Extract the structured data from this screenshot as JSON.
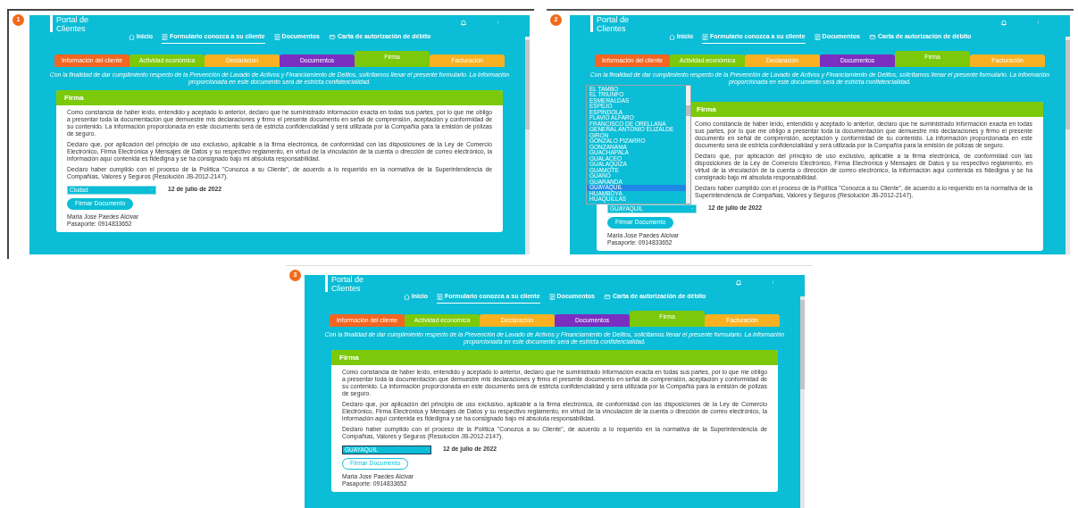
{
  "panels": [
    {
      "badge": "1",
      "portal_title": [
        "Portal de",
        "Clientes"
      ],
      "nav": [
        {
          "kind": "home",
          "label": "Inicio",
          "selected": false
        },
        {
          "kind": "form",
          "label": "Formulario conozca a su cliente",
          "selected": true
        },
        {
          "kind": "documents",
          "label": "Documentos",
          "selected": false
        },
        {
          "kind": "card",
          "label": "Carta de autorización de débito",
          "selected": false
        }
      ],
      "tabs": [
        {
          "label": "Información del cliente",
          "color": "#f26522",
          "selected": false
        },
        {
          "label": "Actividad económica",
          "color": "#7cc90c",
          "selected": false
        },
        {
          "label": "Declaración",
          "color": "#f9b122",
          "selected": false
        },
        {
          "label": "Documentos",
          "color": "#7a2fc0",
          "selected": false
        },
        {
          "label": "Firma",
          "color": "#7cc90c",
          "selected": true
        },
        {
          "label": "Facturación",
          "color": "#f9b122",
          "selected": false
        }
      ],
      "intro": "Con la finalidad de dar cumplimiento respecto de la Prevención de Lavado de Activos y Financiamiento de Delitos, solicitamos llenar el presente formulario. La información proporcionada en este documento será de estricta confidencialidad.",
      "card": {
        "title": "Firma",
        "paragraphs": [
          "Como constancia de haber leído, entendido y aceptado lo anterior, declaro que he suministrado información exacta en todas sus partes, por lo que me obligo a presentar toda la documentación que demuestre mis declaraciones y firmo el presente documento en señal de comprensión, aceptación y conformidad de su contenido. La información proporcionada en este documento será de estricta confidencialidad y será utilizada por la Compañía para la emisión de pólizas de seguro.",
          "Declaro que, por aplicación del principio de uso exclusivo, aplicable a la firma electrónica, de conformidad con las disposiciones de la Ley de Comercio Electrónico, Firma Electrónica y Mensajes de Datos y su respectivo reglamento, en virtud de la vinculación de la cuenta o dirección de correo electrónico, la información aquí contenida es fidedigna y se ha consignado bajo mi absoluta responsabilidad.",
          "Declaro haber cumplido con el proceso de la Política \"Conozca a su Cliente\", de acuerdo a lo requerido en la normativa de la Superintendencia de Compañías, Valores y Seguros (Resolución JB-2012-2147)."
        ],
        "city_select": {
          "value": "Ciudad",
          "open": false,
          "focused": false
        },
        "date": "12 de julio de 2022",
        "sign_button": {
          "label": "Firmar Documento",
          "hovered": false
        },
        "signer_lines": [
          "Maria Jose Paedes Alcivar",
          "Pasaporte: 0914833652"
        ]
      }
    },
    {
      "badge": "2",
      "portal_title": [
        "Portal de",
        "Clientes"
      ],
      "nav": [
        {
          "kind": "home",
          "label": "Inicio",
          "selected": false
        },
        {
          "kind": "form",
          "label": "Formulario conozca a su cliente",
          "selected": true
        },
        {
          "kind": "documents",
          "label": "Documentos",
          "selected": false
        },
        {
          "kind": "card",
          "label": "Carta de autorización de débito",
          "selected": false
        }
      ],
      "tabs": [
        {
          "label": "Información del cliente",
          "color": "#f26522",
          "selected": false
        },
        {
          "label": "Actividad económica",
          "color": "#7cc90c",
          "selected": false
        },
        {
          "label": "Declaración",
          "color": "#f9b122",
          "selected": false
        },
        {
          "label": "Documentos",
          "color": "#7a2fc0",
          "selected": false
        },
        {
          "label": "Firma",
          "color": "#7cc90c",
          "selected": true
        },
        {
          "label": "Facturación",
          "color": "#f9b122",
          "selected": false
        }
      ],
      "intro": "Con la finalidad de dar cumplimiento respecto de la Prevención de Lavado de Activos y Financiamiento de Delitos, solicitamos llenar el presente formulario. La información proporcionada en este documento será de estricta confidencialidad.",
      "card": {
        "title": "Firma",
        "paragraphs": [
          "Como constancia de haber leído, entendido y aceptado lo anterior, declaro que he suministrado información exacta en todas sus partes, por lo que me obligo a presentar toda la documentación que demuestre mis declaraciones y firmo el presente documento en señal de comprensión, aceptación y conformidad de su contenido. La información proporcionada en este documento será de estricta confidencialidad y será utilizada por la Compañía para la emisión de pólizas de seguro.",
          "Declaro que, por aplicación del principio de uso exclusivo, aplicable a la firma electrónica, de conformidad con las disposiciones de la Ley de Comercio Electrónico, Firma Electrónica y Mensajes de Datos y su respectivo reglamento, en virtud de la vinculación de la cuenta o dirección de correo electrónico, la información aquí contenida es fidedigna y se ha consignado bajo mi absoluta responsabilidad.",
          "Declaro haber cumplido con el proceso de la Política \"Conozca a su Cliente\", de acuerdo a lo requerido en la normativa de la Superintendencia de Compañías, Valores y Seguros (Resolución JB-2012-2147)."
        ],
        "city_select": {
          "value": "GUAYAQUIL",
          "open": true,
          "focused": false,
          "options": [
            {
              "label": "EL TAMBO",
              "selected": false
            },
            {
              "label": "EL TRIUNFO",
              "selected": false
            },
            {
              "label": "ESMERALDAS",
              "selected": false
            },
            {
              "label": "ESPEJO",
              "selected": false
            },
            {
              "label": "ESPINDOLA",
              "selected": false
            },
            {
              "label": "FLAVIO ALFARO",
              "selected": false
            },
            {
              "label": "FRANCISCO DE ORELLANA",
              "selected": false
            },
            {
              "label": "GENERAL ANTONIO ELIZALDE",
              "selected": false
            },
            {
              "label": "GIRON",
              "selected": false
            },
            {
              "label": "GONZALO PIZARRO",
              "selected": false
            },
            {
              "label": "GONZANAMA",
              "selected": false
            },
            {
              "label": "GUACHAPALA",
              "selected": false
            },
            {
              "label": "GUALACEO",
              "selected": false
            },
            {
              "label": "GUALAQUIZA",
              "selected": false
            },
            {
              "label": "GUAMOTE",
              "selected": false
            },
            {
              "label": "GUANO",
              "selected": false
            },
            {
              "label": "GUARANDA",
              "selected": false
            },
            {
              "label": "GUAYAQUIL",
              "selected": true
            },
            {
              "label": "HUAMBOYA",
              "selected": false
            },
            {
              "label": "HUAQUILLAS",
              "selected": false
            }
          ]
        },
        "date": "12 de julio de 2022",
        "sign_button": {
          "label": "Firmar Documento",
          "hovered": false
        },
        "signer_lines": [
          "Maria Jose Paedes Alcivar",
          "Pasaporte: 0914833652"
        ]
      }
    },
    {
      "badge": "3",
      "portal_title": [
        "Portal de",
        "Clientes"
      ],
      "nav": [
        {
          "kind": "home",
          "label": "Inicio",
          "selected": false
        },
        {
          "kind": "form",
          "label": "Formulario conozca a su cliente",
          "selected": true
        },
        {
          "kind": "documents",
          "label": "Documentos",
          "selected": false
        },
        {
          "kind": "card",
          "label": "Carta de autorización de débito",
          "selected": false
        }
      ],
      "tabs": [
        {
          "label": "Información del cliente",
          "color": "#f26522",
          "selected": false
        },
        {
          "label": "Actividad económica",
          "color": "#7cc90c",
          "selected": false
        },
        {
          "label": "Declaración",
          "color": "#f9b122",
          "selected": false
        },
        {
          "label": "Documentos",
          "color": "#7a2fc0",
          "selected": false
        },
        {
          "label": "Firma",
          "color": "#7cc90c",
          "selected": true
        },
        {
          "label": "Facturación",
          "color": "#f9b122",
          "selected": false
        }
      ],
      "intro": "Con la finalidad de dar cumplimiento respecto de la Prevención de Lavado de Activos y Financiamiento de Delitos, solicitamos llenar el presente formulario. La información proporcionada en este documento será de estricta confidencialidad.",
      "card": {
        "title": "Firma",
        "paragraphs": [
          "Como constancia de haber leído, entendido y aceptado lo anterior, declaro que he suministrado información exacta en todas sus partes, por lo que me obligo a presentar toda la documentación que demuestre mis declaraciones y firmo el presente documento en señal de comprensión, aceptación y conformidad de su contenido. La información proporcionada en este documento será de estricta confidencialidad y será utilizada por la Compañía para la emisión de pólizas de seguro.",
          "Declaro que, por aplicación del principio de uso exclusivo, aplicable a la firma electrónica, de conformidad con las disposiciones de la Ley de Comercio Electrónico, Firma Electrónica y Mensajes de Datos y su respectivo reglamento, en virtud de la vinculación de la cuenta o dirección de correo electrónico, la información aquí contenida es fidedigna y se ha consignado bajo mi absoluta responsabilidad.",
          "Declaro haber cumplido con el proceso de la Política \"Conozca a su Cliente\", de acuerdo a lo requerido en la normativa de la Superintendencia de Compañías, Valores y Seguros (Resolución JB-2012-2147)."
        ],
        "city_select": {
          "value": "GUAYAQUIL",
          "open": false,
          "focused": true
        },
        "date": "12 de julio de 2022",
        "sign_button": {
          "label": "Firmar Documento",
          "hovered": true
        },
        "signer_lines": [
          "Maria Jose Paedes Alcivar",
          "Pasaporte: 0914833652"
        ]
      }
    }
  ]
}
